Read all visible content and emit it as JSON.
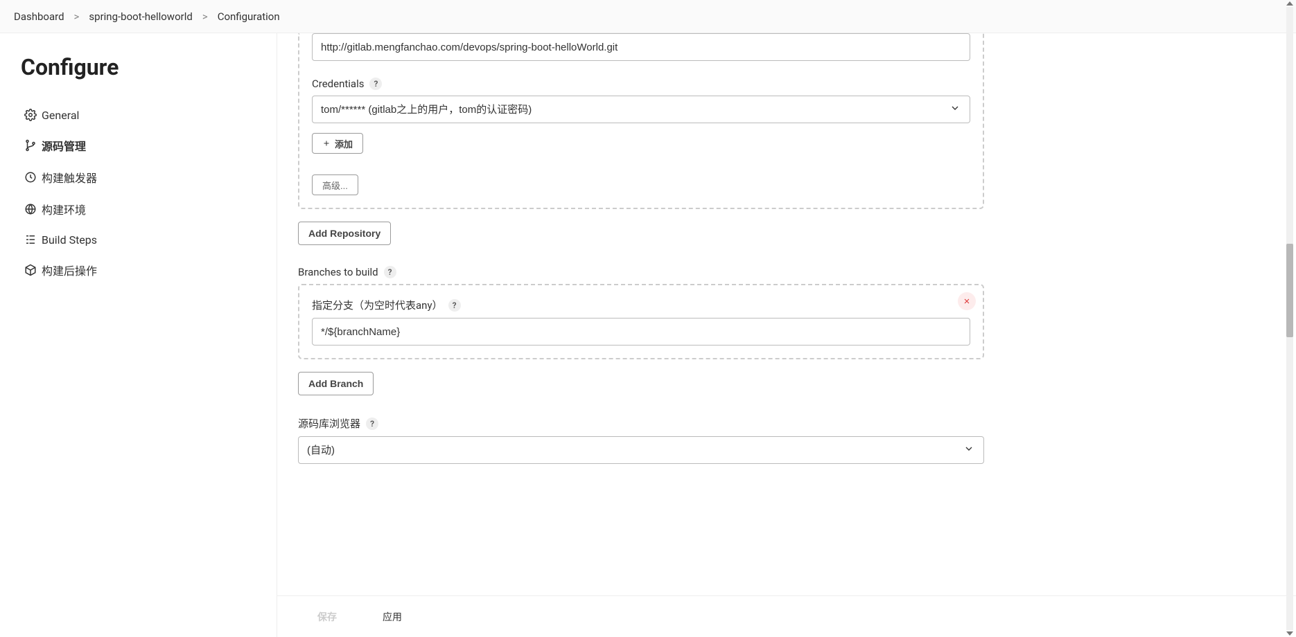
{
  "breadcrumb": {
    "items": [
      "Dashboard",
      "spring-boot-helloworld",
      "Configuration"
    ]
  },
  "sidebar": {
    "title": "Configure",
    "items": [
      {
        "label": "General",
        "icon": "gear-icon",
        "active": false
      },
      {
        "label": "源码管理",
        "icon": "branch-icon",
        "active": true
      },
      {
        "label": "构建触发器",
        "icon": "clock-icon",
        "active": false
      },
      {
        "label": "构建环境",
        "icon": "globe-icon",
        "active": false
      },
      {
        "label": "Build Steps",
        "icon": "steps-icon",
        "active": false
      },
      {
        "label": "构建后操作",
        "icon": "package-icon",
        "active": false
      }
    ]
  },
  "form": {
    "repo_url": "http://gitlab.mengfanchao.com/devops/spring-boot-helloWorld.git",
    "credentials_label": "Credentials",
    "credentials_value": "tom/****** (gitlab之上的用户，tom的认证密码)",
    "add_cred_label": "添加",
    "advanced_label": "高级...",
    "add_repository_label": "Add Repository",
    "branches_label": "Branches to build",
    "branch_specifier_label": "指定分支（为空时代表any）",
    "branch_specifier_value": "*/${branchName}",
    "add_branch_label": "Add Branch",
    "repo_browser_label": "源码库浏览器",
    "repo_browser_value": "(自动)"
  },
  "footer": {
    "save": "保存",
    "apply": "应用"
  },
  "help_glyph": "?"
}
